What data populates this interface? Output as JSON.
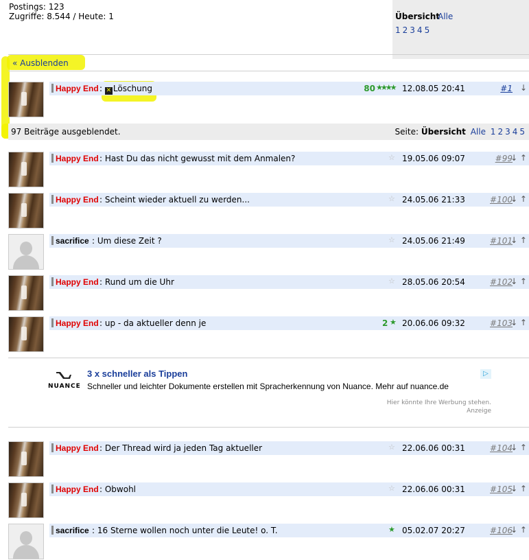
{
  "stats": {
    "postings": "Postings: 123",
    "zugriffe": "Zugriffe: 8.544 / Heute: 1"
  },
  "overview": {
    "label": "Übersicht",
    "alle": "Alle",
    "pages": [
      "1",
      "2",
      "3",
      "4",
      "5"
    ]
  },
  "ausblenden": "« Ausblenden",
  "hidden_bar": {
    "text": "97 Beiträge ausgeblendet.",
    "seite_label": "Seite:",
    "overview": "Übersicht",
    "alle": "Alle",
    "pages": [
      "1",
      "2",
      "3",
      "4",
      "5"
    ]
  },
  "first_post": {
    "author": "Happy End",
    "separator": ":",
    "title": "Löschung",
    "rating": "80",
    "stars": "★★★★",
    "date": "12.08.05 20:41",
    "num": "#1",
    "arrows": "↓"
  },
  "posts": [
    {
      "author": "Happy End",
      "title": ": Hast Du das nicht gewusst mit dem Anmalen?",
      "date": "19.05.06 09:07",
      "num": "#99",
      "arrows": "↓ ↑"
    },
    {
      "author": "Happy End",
      "title": ": Scheint wieder aktuell zu werden...",
      "date": "24.05.06 21:33",
      "num": "#100",
      "arrows": "↓ ↑"
    },
    {
      "author": "sacrifice",
      "title": ": Um diese Zeit ?",
      "date": "24.05.06 21:49",
      "num": "#101",
      "arrows": "↓ ↑"
    },
    {
      "author": "Happy End",
      "title": ": Rund um die Uhr",
      "date": "28.05.06 20:54",
      "num": "#102",
      "arrows": "↓ ↑"
    },
    {
      "author": "Happy End",
      "title": ": up - da aktueller denn je",
      "rating": "2",
      "date": "20.06.06 09:32",
      "num": "#103",
      "arrows": "↓ ↑"
    },
    {
      "author": "Happy End",
      "title": ": Der Thread wird ja jeden Tag aktueller",
      "date": "22.06.06 00:31",
      "num": "#104",
      "arrows": "↓ ↑"
    },
    {
      "author": "Happy End",
      "title": ": Obwohl",
      "date": "22.06.06 00:31",
      "num": "#105",
      "arrows": "↓ ↑"
    },
    {
      "author": "sacrifice",
      "title": ": 16 Sterne wollen noch unter die Leute! o. T.",
      "date": "05.02.07 20:27",
      "num": "#106",
      "arrows": "↓ ↑"
    }
  ],
  "star_glyph_empty": "☆",
  "star_glyph_full": "★",
  "ad": {
    "logo_word": "NUANCE",
    "title": "3 x schneller als Tippen",
    "text": "Schneller und leichter Dokumente erstellen mit Spracherkennung von Nuance. Mehr auf nuance.de",
    "choice": "▷",
    "note1": "Hier könnte Ihre Werbung stehen.",
    "note2": "Anzeige"
  },
  "colors": {
    "author_red": "#e00000",
    "bar_bg": "#e3ecfa",
    "link": "#1a3e9a",
    "rating_green": "#2d9a2d",
    "highlight": "#f2f200"
  }
}
